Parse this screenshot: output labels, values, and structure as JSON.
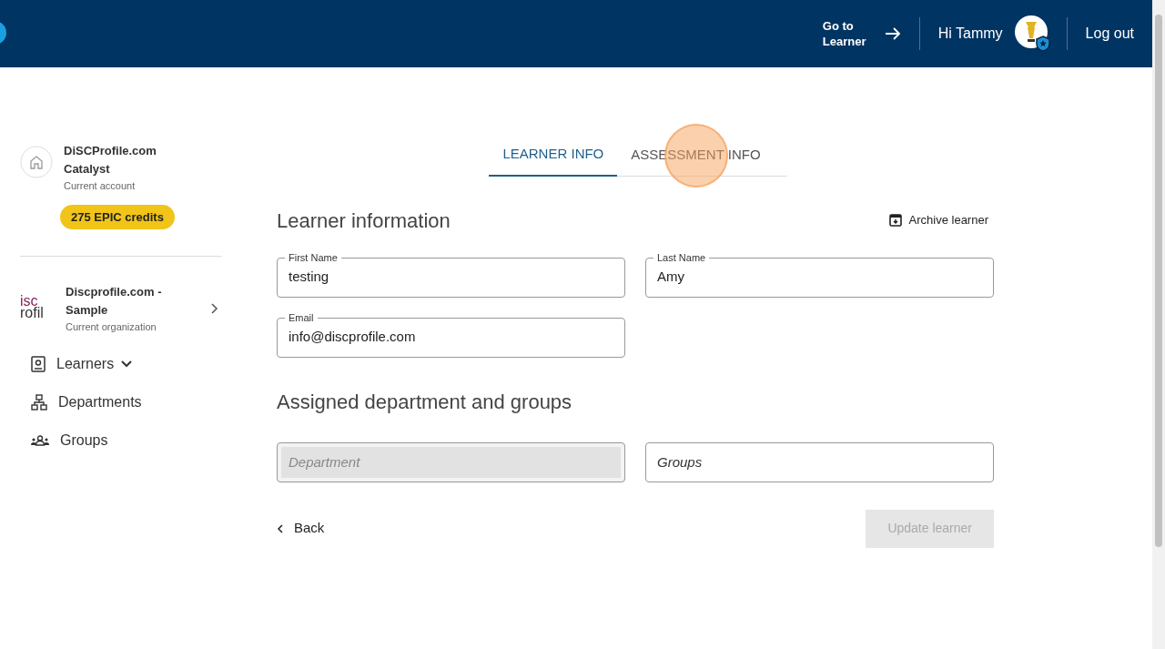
{
  "header": {
    "go_to": "Go to Learner",
    "greeting": "Hi Tammy",
    "logout": "Log out"
  },
  "sidebar": {
    "account": {
      "name": "DiSCProfile.com Catalyst",
      "caption": "Current account",
      "credits": "275 EPIC credits"
    },
    "organization": {
      "logo_lines": [
        "isc",
        "rofil"
      ],
      "name": "Discprofile.com - Sample",
      "caption": "Current organization"
    },
    "items": [
      {
        "kind": "learners",
        "label": "Learners",
        "expanded": false
      },
      {
        "kind": "departments",
        "label": "Departments"
      },
      {
        "kind": "groups",
        "label": "Groups"
      }
    ]
  },
  "tabs": [
    {
      "label": "LEARNER INFO",
      "selected": true
    },
    {
      "label": "ASSESSMENT INFO",
      "selected": false
    }
  ],
  "section_title": "Learner information",
  "archive": "Archive learner",
  "fields": [
    {
      "label": "First Name",
      "value": "testing"
    },
    {
      "label": "Last Name",
      "value": "Amy"
    },
    {
      "label": "Email",
      "value": "info@discprofile.com"
    }
  ],
  "assigned_title": "Assigned department and groups",
  "selects": [
    {
      "placeholder": "Department",
      "disabled": true
    },
    {
      "placeholder": "Groups",
      "disabled": false
    }
  ],
  "back": "Back",
  "update": {
    "label": "Update learner",
    "disabled": true
  }
}
